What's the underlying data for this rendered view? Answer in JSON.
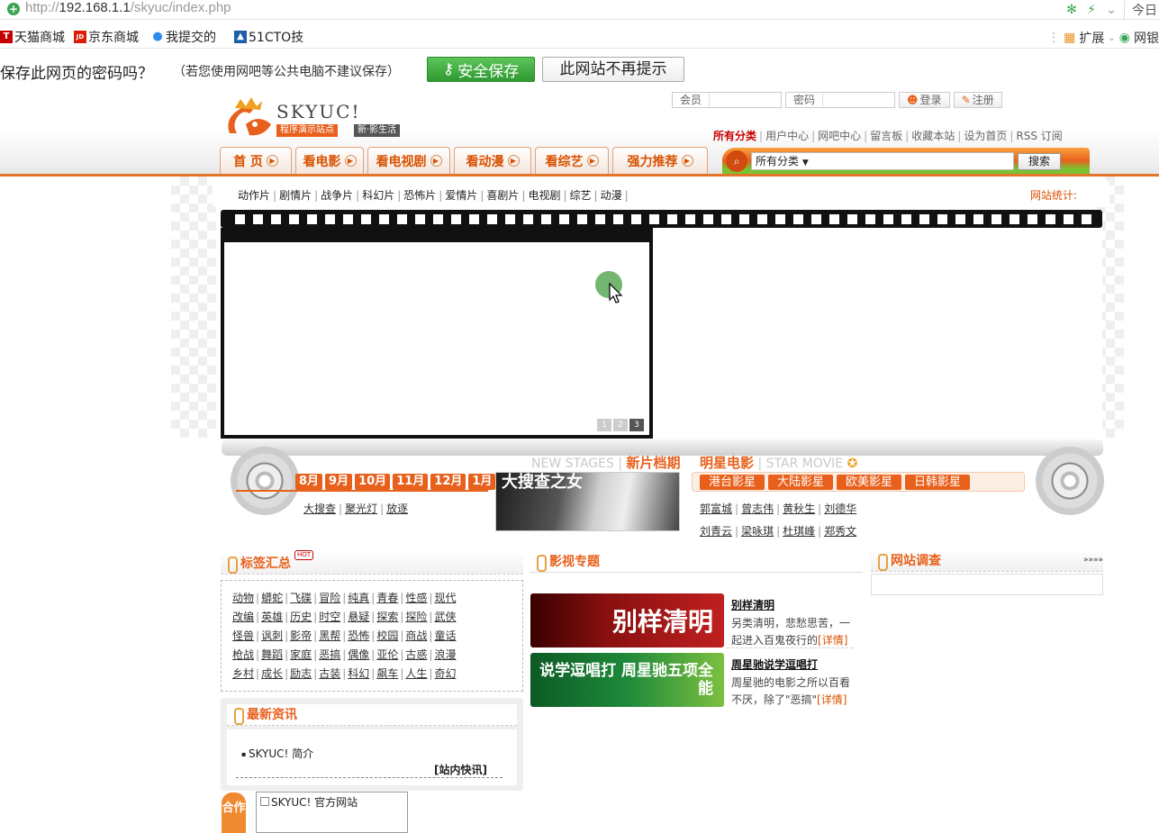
{
  "browser": {
    "url_host": "192.168.1.1",
    "url_prefix": "http://",
    "url_path": "/skyuc/index.php",
    "today_label": "今日"
  },
  "favorites": [
    {
      "label": "天猫商城",
      "icon": "tmall-icon",
      "color": "#c40000",
      "glyph": "T"
    },
    {
      "label": "京东商城",
      "icon": "jd-icon",
      "color": "#d81e06",
      "glyph": "JD"
    },
    {
      "label": "我提交的",
      "icon": "submit-icon",
      "color": "#2d8cf0",
      "glyph": "●"
    },
    {
      "label": "51CTO技",
      "icon": "51cto-icon",
      "color": "#1a5fa8",
      "glyph": "▲"
    }
  ],
  "favbar_right": {
    "extensions": "扩展",
    "bank": "网银"
  },
  "password_bar": {
    "question": "保存此网页的密码吗？",
    "note": "（若您使用网吧等公共电脑不建议保存）",
    "save": "安全保存",
    "never": "此网站不再提示"
  },
  "logo": {
    "name": "SKYUC!",
    "sub1": "程序演示站点",
    "sub2": "新·影生活"
  },
  "login": {
    "member": "会员",
    "password": "密码",
    "login_btn": "登录",
    "register_btn": "注册"
  },
  "top_links": [
    "所有分类",
    "用户中心",
    "网吧中心",
    "留言板",
    "收藏本站",
    "设为首页",
    "RSS 订阅"
  ],
  "nav": [
    "首 页",
    "看电影",
    "看电视剧",
    "看动漫",
    "看综艺",
    "强力推荐"
  ],
  "search": {
    "category": "所有分类",
    "button": "搜索"
  },
  "subnav": [
    "动作片",
    "剧情片",
    "战争片",
    "科幻片",
    "恐怖片",
    "爱情片",
    "喜剧片",
    "电视剧",
    "综艺",
    "动漫"
  ],
  "stats_label": "网站统计:",
  "slider_pages": [
    "1",
    "2",
    "3"
  ],
  "months": [
    "8月",
    "9月",
    "10月",
    "11月",
    "12月",
    "1月"
  ],
  "month_films": [
    "大搜查",
    "聚光灯",
    "放逐"
  ],
  "new_stages": {
    "en": "NEW STAGES",
    "cn": "新片档期",
    "poster_text": "大搜查之女"
  },
  "star_movie": {
    "cn": "明星电影",
    "en": "STAR MOVIE"
  },
  "star_tabs": [
    "港台影星",
    "大陆影星",
    "欧美影星",
    "日韩影星"
  ],
  "stars_row1": [
    "郭富城",
    "曾志伟",
    "黄秋生",
    "刘德华"
  ],
  "stars_row2": [
    "刘青云",
    "梁咏琪",
    "杜琪峰",
    "郑秀文"
  ],
  "tags": {
    "title": "标签汇总",
    "hot": "HOT",
    "rows": [
      [
        "动物",
        "蟒蛇",
        "飞碟",
        "冒险",
        "纯真",
        "青春",
        "性感",
        "现代"
      ],
      [
        "改编",
        "英雄",
        "历史",
        "时空",
        "悬疑",
        "探索",
        "探险",
        "武侠"
      ],
      [
        "怪兽",
        "讽刺",
        "影帝",
        "黑帮",
        "恐怖",
        "校园",
        "商战",
        "童话"
      ],
      [
        "枪战",
        "舞蹈",
        "家庭",
        "恶搞",
        "偶像",
        "亚伦",
        "古惑",
        "浪漫"
      ],
      [
        "乡村",
        "成长",
        "励志",
        "古装",
        "科幻",
        "飙车",
        "人生",
        "奇幻"
      ]
    ]
  },
  "news": {
    "title": "最新资讯",
    "item": "SKYUC! 简介",
    "more": "[站内快讯]"
  },
  "topics": {
    "title": "影视专题",
    "items": [
      {
        "title": "别样清明",
        "desc": "另类清明，悲愁思苦，一起进入百鬼夜行的",
        "more": "[详情]",
        "banner": "别样清明",
        "bg": "#8a1010"
      },
      {
        "title": "周星驰说学逗唱打",
        "desc": "周星驰的电影之所以百看不厌，除了\"恶搞\"",
        "more": "[详情]",
        "banner": "说学逗唱打 周星驰五项全能",
        "bg": "#1e8a3a"
      }
    ]
  },
  "survey": {
    "title": "网站调查",
    "more": "»»»»"
  },
  "coop": {
    "tag": "合作",
    "img_alt": "SKYUC! 官方网站"
  }
}
